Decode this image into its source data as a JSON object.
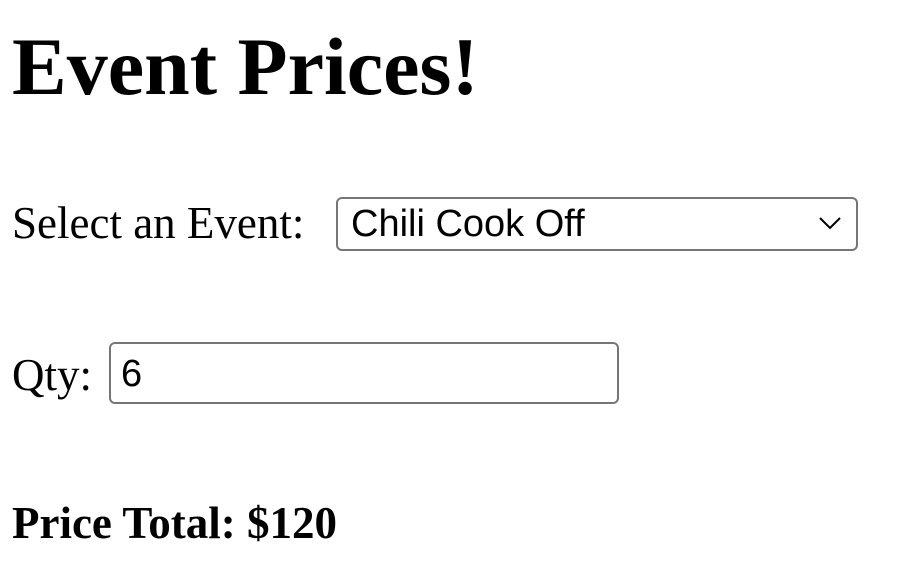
{
  "title": "Event Prices!",
  "event_select": {
    "label": "Select an Event:",
    "value": "Chili Cook Off"
  },
  "qty": {
    "label": "Qty:",
    "value": "6"
  },
  "total": {
    "label": "Price Total:",
    "value": "$120"
  }
}
